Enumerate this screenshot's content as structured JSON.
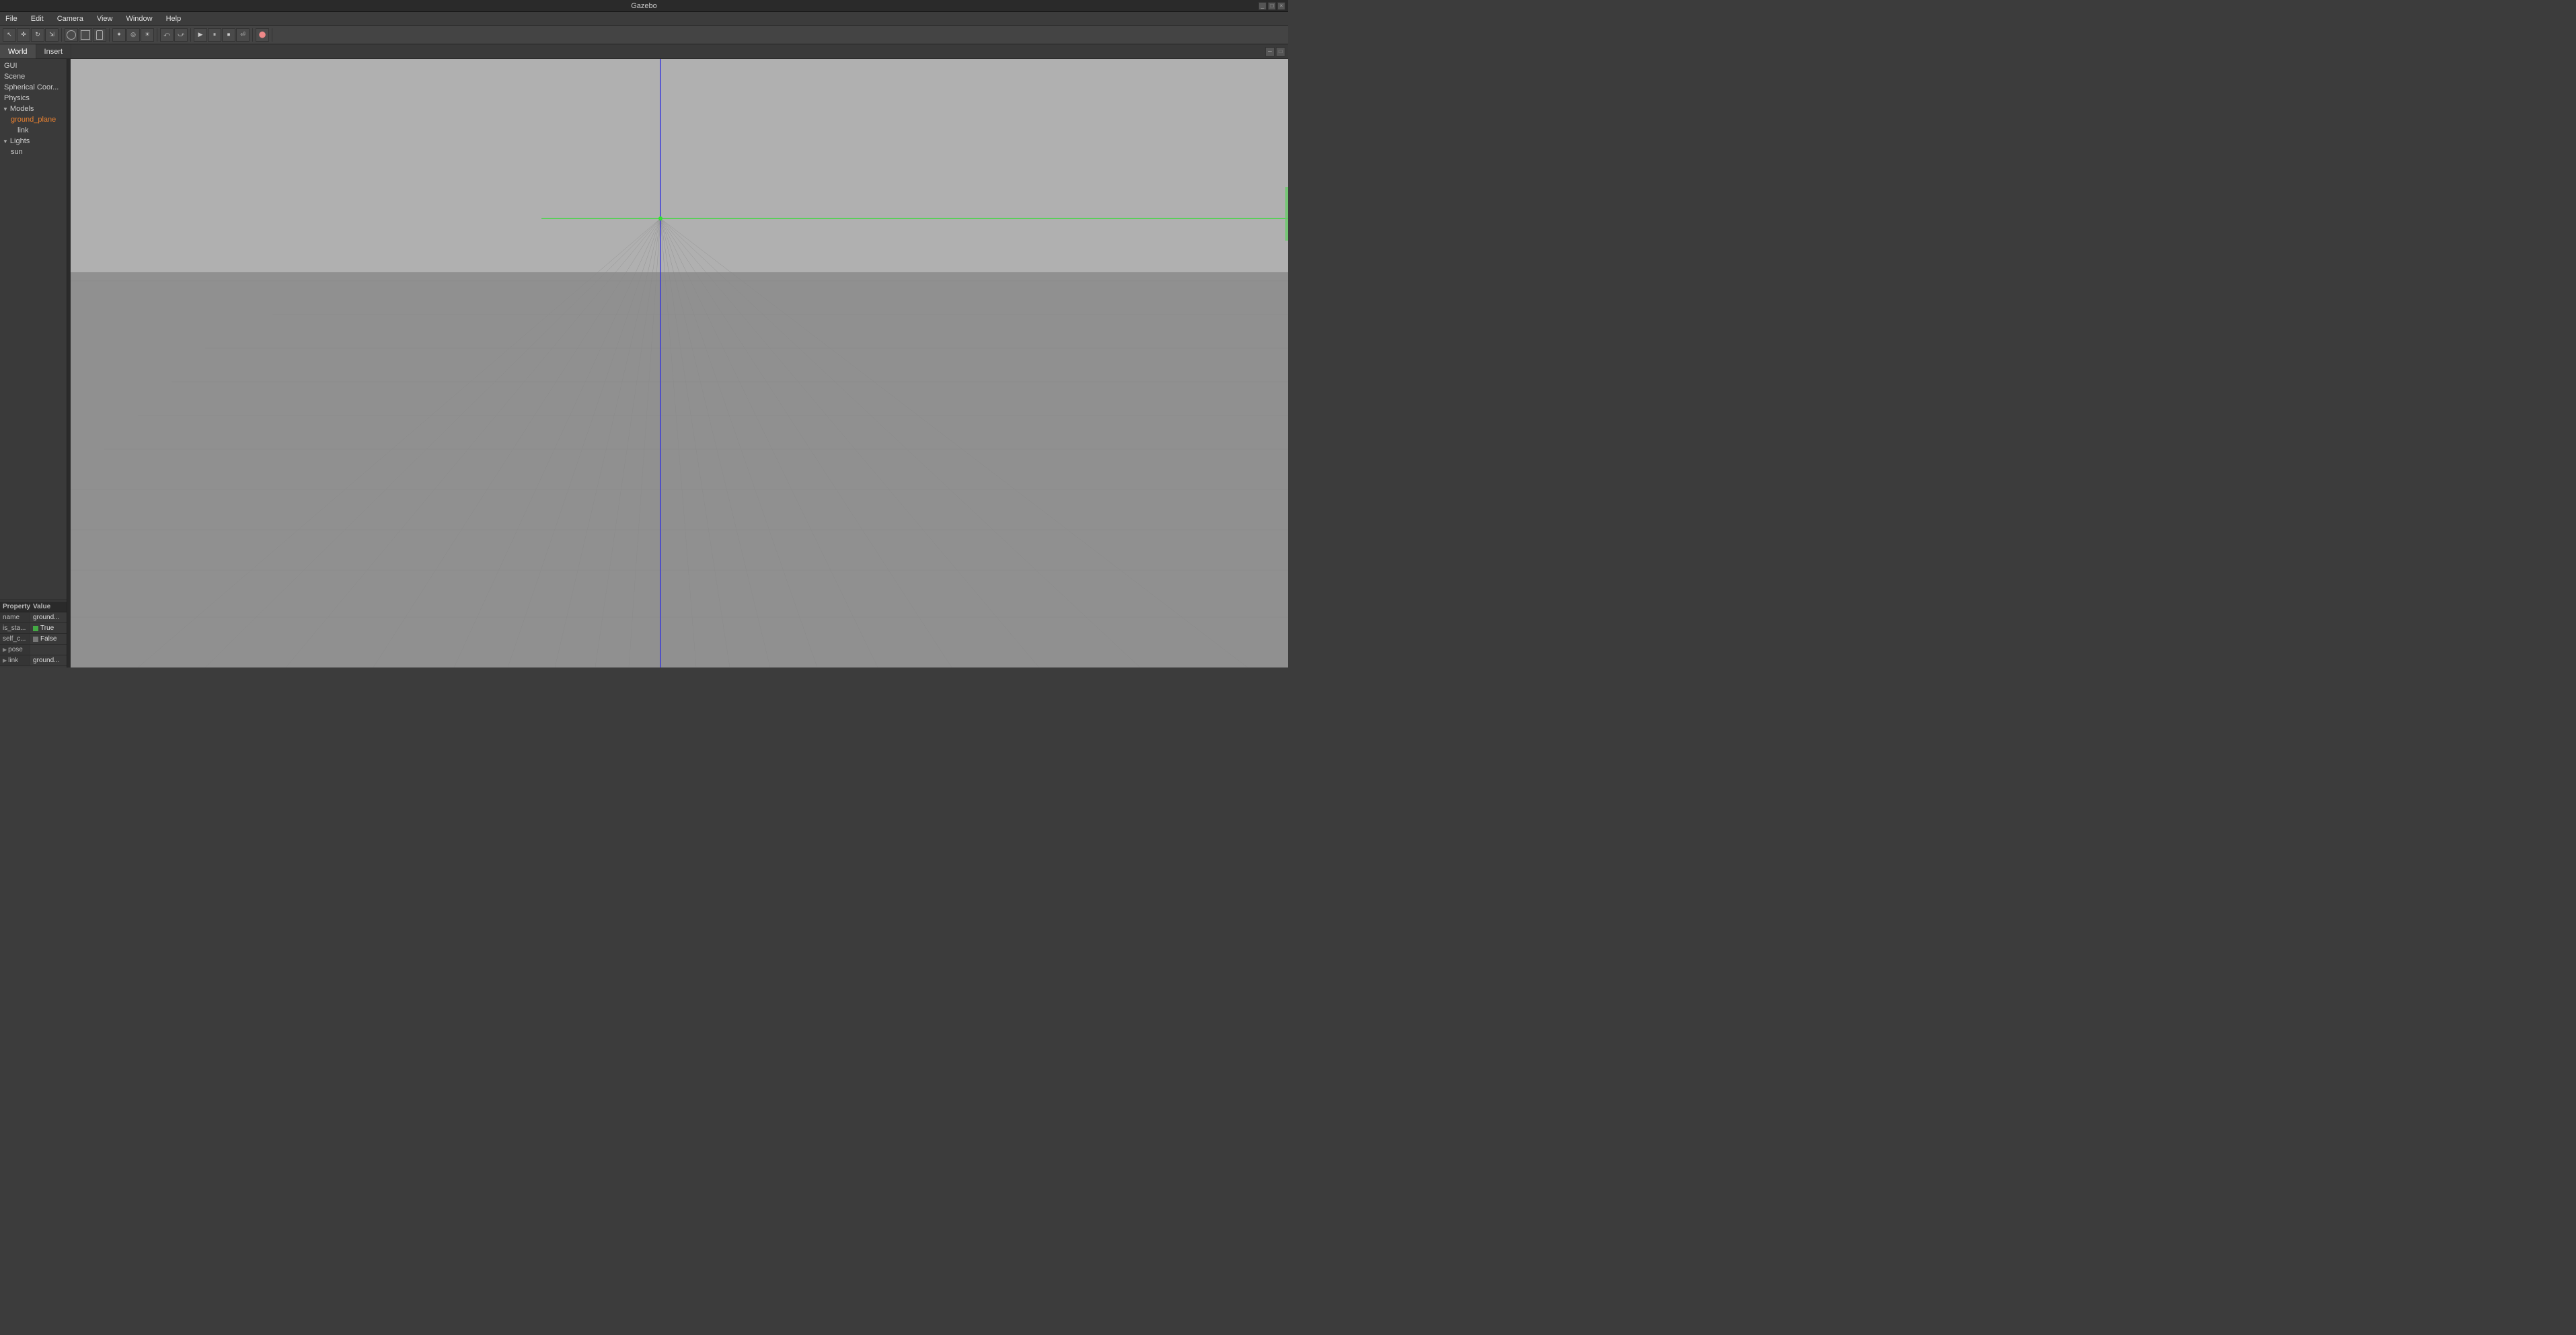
{
  "titlebar": {
    "title": "Gazebo",
    "minimize": "_",
    "maximize": "□",
    "close": "×"
  },
  "menubar": {
    "items": [
      "File",
      "Edit",
      "Camera",
      "View",
      "Window",
      "Help"
    ]
  },
  "toolbar": {
    "groups": [
      {
        "buttons": [
          "↖",
          "✜",
          "⊕",
          "✦",
          "⟲"
        ]
      },
      {
        "shapes": [
          "sphere",
          "box",
          "cylinder"
        ]
      },
      {
        "buttons": [
          "⤺",
          "⤻",
          "▶",
          "⏸",
          "⏹",
          "⏎",
          "🔥"
        ]
      }
    ]
  },
  "tabs": {
    "world_tab": "World",
    "insert_tab": "Insert",
    "minimize": "─",
    "maximize": "□"
  },
  "world_tree": {
    "gui": "GUI",
    "scene": "Scene",
    "spherical_coord": "Spherical Coor...",
    "physics": "Physics",
    "models_section": "Models",
    "ground_plane": "ground_plane",
    "link": "link",
    "lights_section": "Lights",
    "sun": "sun"
  },
  "property_panel": {
    "col_property": "Property",
    "col_value": "Value",
    "rows": [
      {
        "key": "name",
        "value": "ground...",
        "type": "text"
      },
      {
        "key": "is_sta...",
        "value": "True",
        "type": "bool_true"
      },
      {
        "key": "self_c...",
        "value": "False",
        "type": "bool_false"
      },
      {
        "key": "pose",
        "value": "",
        "type": "expandable"
      },
      {
        "key": "link",
        "value": "ground...",
        "type": "expandable"
      }
    ]
  },
  "viewport": {
    "grid_visible": true,
    "axis_visible": true
  }
}
